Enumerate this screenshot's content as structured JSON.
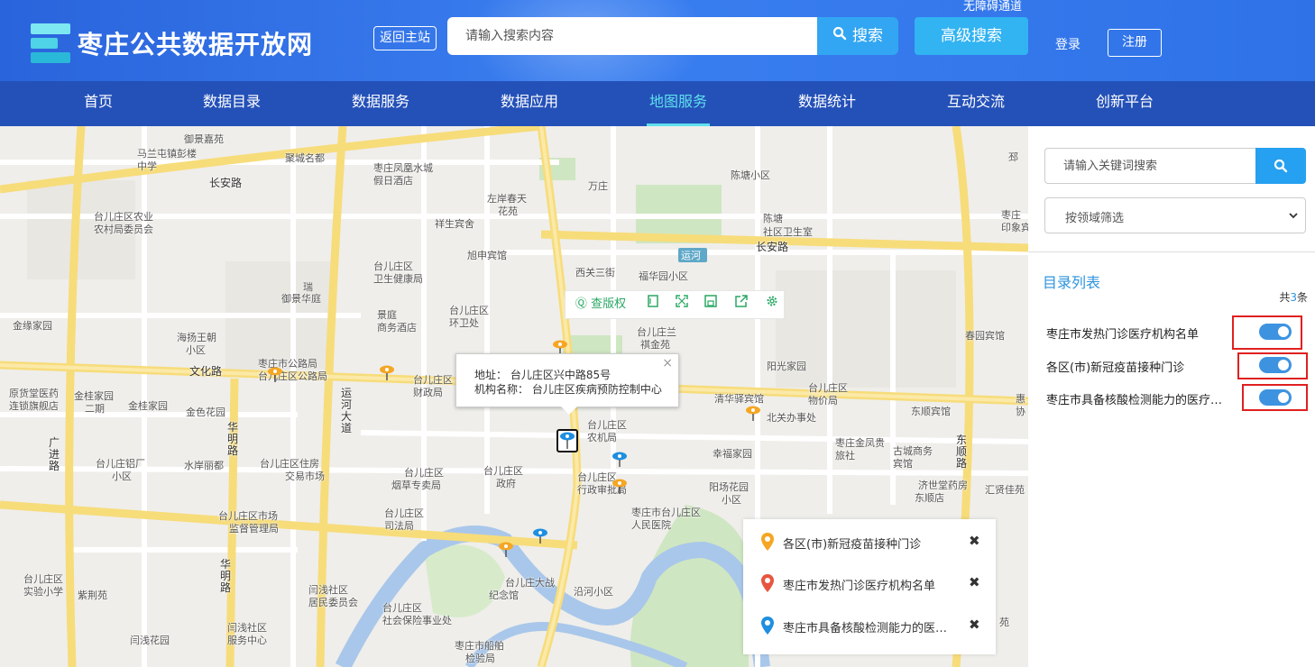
{
  "header": {
    "site_title": "枣庄公共数据开放网",
    "back_label": "返回主站",
    "search_placeholder": "请输入搜索内容",
    "search_button": "搜索",
    "advanced_search": "高级搜索",
    "barrier_free": "无障碍通道",
    "login": "登录",
    "register": "注册"
  },
  "nav": {
    "items": [
      "首页",
      "数据目录",
      "数据服务",
      "数据应用",
      "地图服务",
      "数据统计",
      "互动交流",
      "创新平台"
    ],
    "active": "地图服务"
  },
  "map": {
    "toolbar": {
      "copyright_label": "查版权"
    },
    "popup": {
      "address": "地址： 台儿庄区兴中路85号",
      "org": "机构名称： 台儿庄区疾病预防控制中心"
    },
    "labels": [
      "御景嘉苑",
      "马兰屯镇彭楼",
      "中学",
      "聚城名都",
      "枣庄凤凰水城",
      "假日酒店",
      "邳",
      "长安路",
      "万庄",
      "陈塘小区",
      "左岸春天",
      "花苑",
      "台儿庄区农业",
      "农村局委员会",
      "祥生宾舍",
      "陈塘",
      "社区卫生室",
      "枣庄",
      "印象宾",
      "长安路",
      "运河",
      "旭申宾馆",
      "西关三街",
      "福华园小区",
      "台儿庄区",
      "卫生健康局",
      "瑞",
      "御景华庭",
      "台儿庄区",
      "环卫处",
      "景庭",
      "商务酒店",
      "台儿庄兰",
      "祺金苑",
      "金缘家园",
      "海扬王朝",
      "小区",
      "春园宾馆",
      "阳光家园",
      "枣庄市公路局",
      "台儿庄区公路局",
      "文化路",
      "台儿庄区",
      "财政局",
      "原货堂医药",
      "连锁旗舰店",
      "金桂家园",
      "二期",
      "金桂家园",
      "运河大道",
      "清华驿宾馆",
      "台儿庄区",
      "物价局",
      "惠",
      "协",
      "金色花园",
      "北关办事处",
      "东顺宾馆",
      "华明路",
      "广进路",
      "台儿庄区",
      "农机局",
      "台儿庄铝厂",
      "小区",
      "水岸丽都",
      "台儿庄区住房",
      "交易市场",
      "枣庄金凤贵",
      "旅社",
      "古城商务",
      "宾馆",
      "东顺路",
      "幸福家园",
      "台儿庄区",
      "烟草专卖局",
      "台儿庄区",
      "政府",
      "台儿庄区",
      "行政审批局",
      "阳场花园",
      "小区",
      "济世堂药房",
      "东顺店",
      "汇贤佳苑",
      "台儿庄区市场",
      "监督管理局",
      "台儿庄区",
      "司法局",
      "枣庄市台儿庄区",
      "人民医院",
      "台儿庄区",
      "实验小学",
      "紫荆苑",
      "华明路",
      "闫浅社区",
      "居民委员会",
      "台儿庄大战",
      "纪念馆",
      "沿河小区",
      "台儿庄区",
      "社会保险事业处",
      "闫浅社区",
      "服务中心",
      "闫浅花园",
      "枣庄市船舶",
      "检验局",
      "苑"
    ]
  },
  "legend": {
    "items": [
      {
        "label": "各区(市)新冠疫苗接种门诊",
        "color": "#f5a623",
        "close": "✖"
      },
      {
        "label": "枣庄市发热门诊医疗机构名单",
        "color": "#e8553f",
        "close": "✖"
      },
      {
        "label": "枣庄市具备核酸检测能力的医疗卫生机构名单",
        "color": "#1f8fe0",
        "close": "✖"
      }
    ]
  },
  "panel": {
    "keyword_placeholder": "请输入关键词搜索",
    "domain_filter": "按领域筛选",
    "catalog_title": "目录列表",
    "count_prefix": "共",
    "count_value": "3",
    "count_suffix": "条",
    "layers": [
      {
        "label": "枣庄市发热门诊医疗机构名单",
        "on": true
      },
      {
        "label": "各区(市)新冠疫苗接种门诊",
        "on": true
      },
      {
        "label": "枣庄市具备核酸检测能力的医疗卫生机构名单",
        "on": true
      }
    ]
  },
  "colors": {
    "header_bg": "#2f72e8",
    "nav_bg": "#2451b8",
    "nav_active": "#5fe0ee",
    "accent": "#26a0f0",
    "highlight_box": "#e02020"
  }
}
